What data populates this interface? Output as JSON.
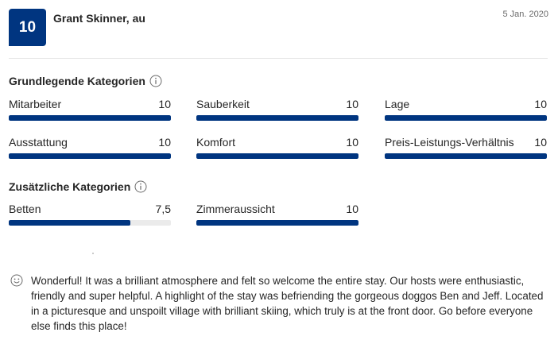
{
  "review": {
    "score": "10",
    "reviewer": "Grant Skinner, au",
    "date": "5 Jan. 2020",
    "text": "Wonderful! It was a brilliant atmosphere and felt so welcome the entire stay. Our hosts were enthusiastic, friendly and super helpful. A highlight of the stay was befriending the gorgeous doggos Ben and Jeff. Located in a picturesque and unspoilt village with brilliant skiing, which truly is at the front door. Go before everyone else finds this place!"
  },
  "basic_categories": {
    "title": "Grundlegende Kategorien",
    "items": [
      {
        "label": "Mitarbeiter",
        "score": "10",
        "fill_fraction": 1.0
      },
      {
        "label": "Sauberkeit",
        "score": "10",
        "fill_fraction": 1.0
      },
      {
        "label": "Lage",
        "score": "10",
        "fill_fraction": 1.0
      },
      {
        "label": "Ausstattung",
        "score": "10",
        "fill_fraction": 1.0
      },
      {
        "label": "Komfort",
        "score": "10",
        "fill_fraction": 1.0
      },
      {
        "label": "Preis-Leistungs-Verhältnis",
        "score": "10",
        "fill_fraction": 1.0
      }
    ]
  },
  "extra_categories": {
    "title": "Zusätzliche Kategorien",
    "items": [
      {
        "label": "Betten",
        "score": "7,5",
        "fill_fraction": 0.75
      },
      {
        "label": "Zimmeraussicht",
        "score": "10",
        "fill_fraction": 1.0
      }
    ]
  },
  "icons": {
    "info": "info-icon",
    "positive_review": "smiley-icon"
  },
  "colors": {
    "brand": "#003580",
    "bar_track": "#ebebeb"
  }
}
